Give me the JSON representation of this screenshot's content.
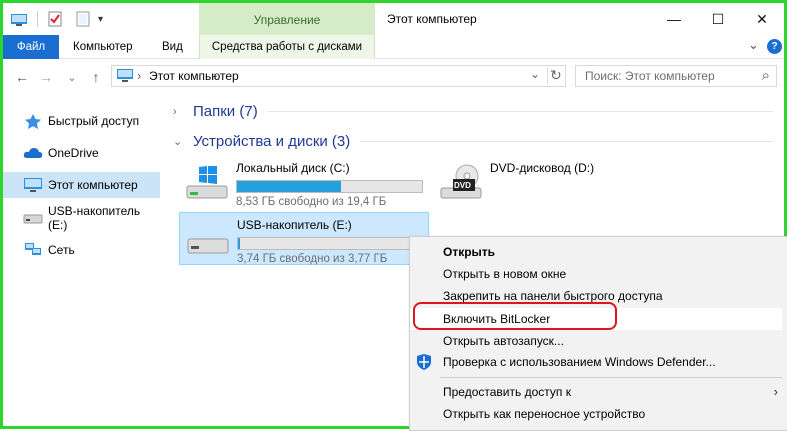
{
  "window": {
    "title": "Этот компьютер",
    "context_tab": "Управление",
    "controls": {
      "minimize": "—",
      "maximize": "☐",
      "close": "✕"
    }
  },
  "ribbon": {
    "tabs": [
      "Файл",
      "Компьютер",
      "Вид",
      "Средства работы с дисками"
    ],
    "collapse_glyph": "⌄",
    "help_glyph": "?"
  },
  "nav": {
    "back": "←",
    "forward": "→",
    "recent": "⌄",
    "up": "↑",
    "address": "Этот компьютер",
    "address_sep": "›",
    "address_dropdown": "⌄",
    "refresh": "↻",
    "search_placeholder": "Поиск: Этот компьютер",
    "search_glyph": "⌕"
  },
  "sidebar": {
    "items": [
      {
        "label": "Быстрый доступ",
        "icon": "star-icon"
      },
      {
        "label": "OneDrive",
        "icon": "cloud-icon"
      },
      {
        "label": "Этот компьютер",
        "icon": "computer-icon",
        "selected": true
      },
      {
        "label": "USB-накопитель (E:)",
        "icon": "usb-drive-icon"
      },
      {
        "label": "Сеть",
        "icon": "network-icon"
      }
    ]
  },
  "content": {
    "groups": [
      {
        "label": "Папки (7)",
        "expanded": false,
        "chevron": "›"
      },
      {
        "label": "Устройства и диски (3)",
        "expanded": true,
        "chevron": "⌄"
      }
    ],
    "drives": [
      {
        "name": "Локальный диск (C:)",
        "free": "8,53 ГБ свободно из 19,4 ГБ",
        "used_fraction": 0.56,
        "icon": "windows-drive-icon"
      },
      {
        "name": "DVD-дисковод (D:)",
        "icon": "dvd-drive-icon",
        "badge": "DVD"
      },
      {
        "name": "USB-накопитель (E:)",
        "free": "3,74 ГБ свободно из 3,77 ГБ",
        "used_fraction": 0.01,
        "icon": "usb-drive-icon",
        "selected": true
      }
    ]
  },
  "context_menu": {
    "items": [
      {
        "label": "Открыть",
        "bold": true
      },
      {
        "label": "Открыть в новом окне"
      },
      {
        "label": "Закрепить на панели быстрого доступа"
      },
      {
        "label": "Включить BitLocker",
        "highlighted": true
      },
      {
        "label": "Открыть автозапуск..."
      },
      {
        "label": "Проверка с использованием Windows Defender...",
        "icon": "windows-defender-icon"
      },
      {
        "label": "Предоставить доступ к",
        "submenu": true
      },
      {
        "label": "Открыть как переносное устройство"
      }
    ],
    "submenu_glyph": "›"
  },
  "colors": {
    "accent": "#1a6dd1",
    "context_tab_bg": "#d6ecc8",
    "selection": "#cce8ff",
    "progress": "#26a0da",
    "annotation": "#e0141e",
    "frame": "#2fd52f"
  }
}
